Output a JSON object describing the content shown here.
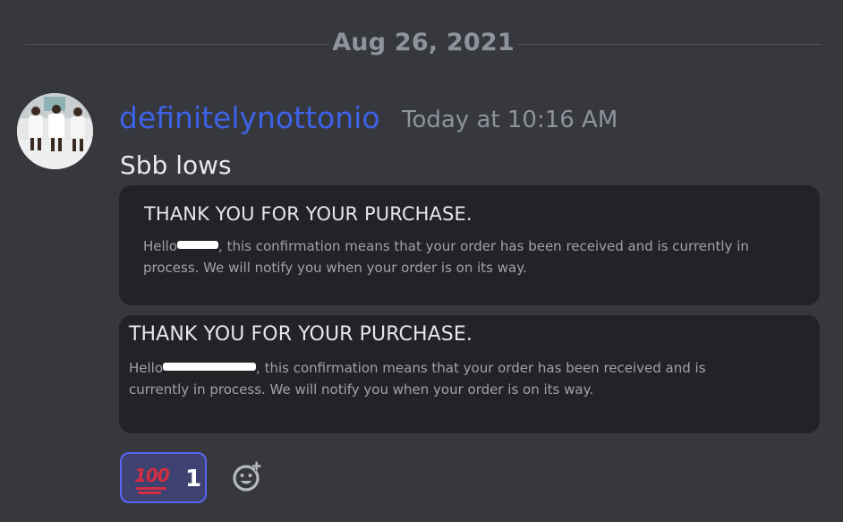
{
  "date_divider": "Aug 26, 2021",
  "message": {
    "username": "definitelynottonio",
    "timestamp": "Today at 10:16 AM",
    "text": "Sbb lows",
    "username_color": "#3d62e6"
  },
  "embeds": [
    {
      "title": "THANK YOU FOR YOUR PURCHASE.",
      "greeting": "Hello",
      "body": ", this confirmation means that your order has been received and is currently in process. We will notify you when your order is on its way."
    },
    {
      "title": "THANK YOU FOR YOUR PURCHASE.",
      "greeting": "Hello",
      "body": ", this confirmation means that your order has been received and is currently in process. We will notify you when your order is on its way."
    }
  ],
  "reactions": [
    {
      "emoji": "100",
      "icon": "hundred-points-emoji",
      "count": "1",
      "accent": "#5865f2"
    }
  ],
  "add_reaction_icon": "add-reaction-icon"
}
